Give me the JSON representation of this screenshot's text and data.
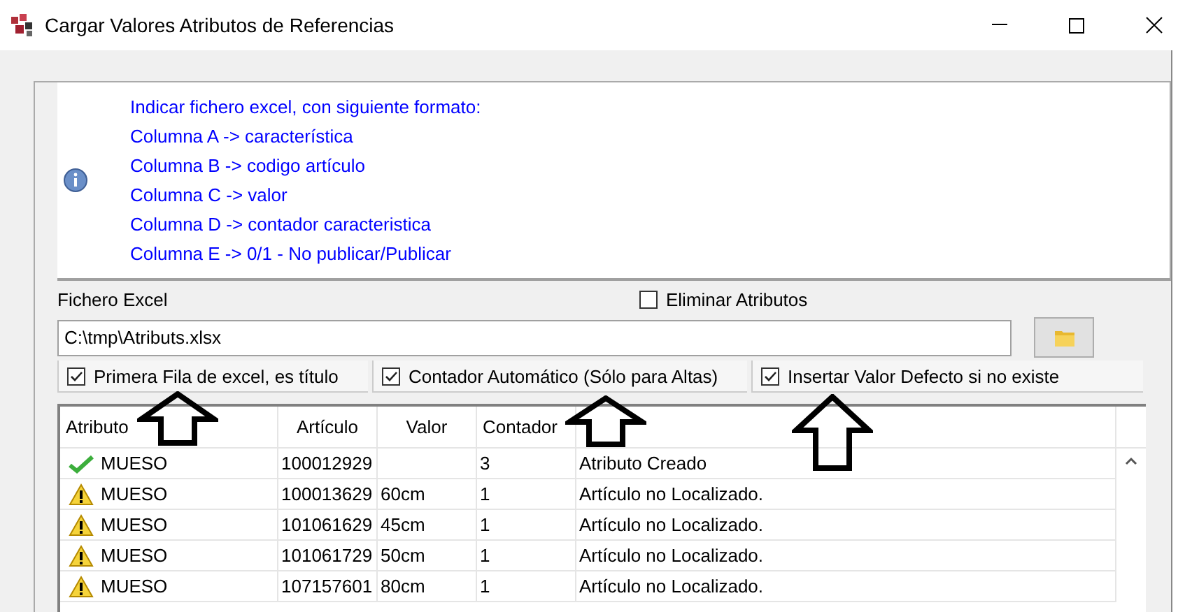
{
  "window": {
    "title": "Cargar Valores Atributos de Referencias"
  },
  "info": {
    "lines": [
      "Indicar fichero excel, con siguiente formato:",
      "Columna A -> característica",
      "Columna B -> codigo artículo",
      "Columna C -> valor",
      "Columna D -> contador caracteristica",
      "Columna E -> 0/1 - No publicar/Publicar"
    ]
  },
  "file": {
    "label": "Fichero Excel",
    "value": "C:\\tmp\\Atributs.xlsx"
  },
  "delete_option": {
    "label": "Eliminar Atributos",
    "checked": false
  },
  "options": [
    {
      "label": "Primera Fila de excel, es título",
      "checked": true
    },
    {
      "label": "Contador Automático (Sólo para Altas)",
      "checked": true
    },
    {
      "label": "Insertar Valor Defecto si no existe",
      "checked": true
    }
  ],
  "table": {
    "columns": [
      "Atributo",
      "Artículo",
      "Valor",
      "Contador"
    ],
    "rows": [
      {
        "kind": "ok",
        "atributo": "MUESO",
        "articulo": "100012929",
        "valor": "",
        "contador": "3",
        "message": "Atributo Creado"
      },
      {
        "kind": "warning",
        "atributo": "MUESO",
        "articulo": "100013629",
        "valor": "60cm",
        "contador": "1",
        "message": "Artículo no Localizado."
      },
      {
        "kind": "warning",
        "atributo": "MUESO",
        "articulo": "101061629",
        "valor": "45cm",
        "contador": "1",
        "message": "Artículo no Localizado."
      },
      {
        "kind": "warning",
        "atributo": "MUESO",
        "articulo": "101061729",
        "valor": "50cm",
        "contador": "1",
        "message": "Artículo no Localizado."
      },
      {
        "kind": "warning",
        "atributo": "MUESO",
        "articulo": "107157601",
        "valor": "80cm",
        "contador": "1",
        "message": "Artículo no Localizado."
      }
    ]
  },
  "annotations": [
    {
      "kind": "arrow"
    },
    {
      "kind": "arrow"
    },
    {
      "kind": "arrow"
    }
  ]
}
